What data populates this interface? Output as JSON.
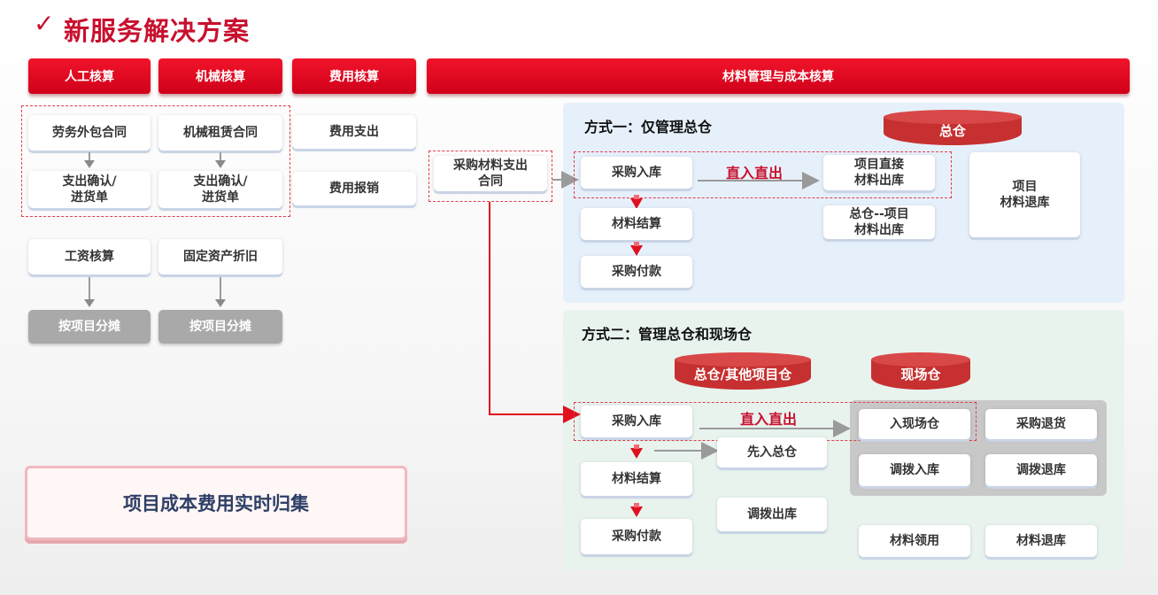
{
  "title": {
    "check": "✓",
    "text": "新服务解决方案"
  },
  "headers": {
    "labor": "人工核算",
    "machine": "机械核算",
    "expense": "费用核算",
    "material": "材料管理与成本核算"
  },
  "left": {
    "labor_contract": "劳务外包合同",
    "labor_confirm": "支出确认/\n进货单",
    "machine_contract": "机械租赁合同",
    "machine_confirm": "支出确认/\n进货单",
    "expense_out": "费用支出",
    "expense_reimburse": "费用报销",
    "wage": "工资核算",
    "fixed_asset": "固定资产折旧",
    "alloc1": "按项目分摊",
    "alloc2": "按项目分摊",
    "summary": "项目成本费用实时归集"
  },
  "material_contract": "采购材料支出\n合同",
  "mode1": {
    "label": "方式一：仅管理总仓",
    "warehouse": "总仓",
    "purchase_in": "采购入库",
    "direct": "直入直出",
    "project_direct_out": "项目直接\n材料出库",
    "general_project_out": "总仓--项目\n材料出库",
    "project_return": "项目\n材料退库",
    "settle": "材料结算",
    "pay": "采购付款"
  },
  "mode2": {
    "label": "方式二：管理总仓和现场仓",
    "warehouse_general": "总仓/其他项目仓",
    "warehouse_site": "现场仓",
    "purchase_in": "采购入库",
    "direct": "直入直出",
    "site_in": "入现场仓",
    "purchase_return": "采购退货",
    "transfer_in": "调拨入库",
    "transfer_return": "调拨退库",
    "first_general": "先入总仓",
    "transfer_out": "调拨出库",
    "settle": "材料结算",
    "pay": "采购付款",
    "material_use": "材料领用",
    "material_return": "材料退库"
  }
}
